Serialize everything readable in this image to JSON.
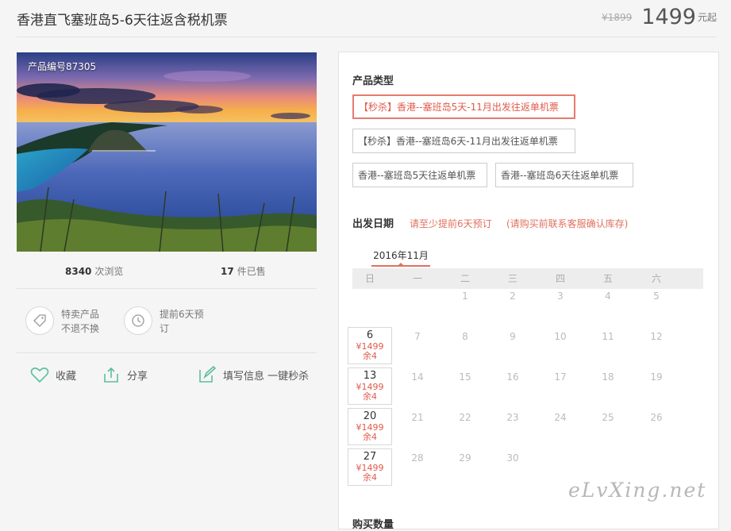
{
  "product": {
    "title": "香港直飞塞班岛5-6天往返含税机票",
    "old_price": "¥1899",
    "price": "1499",
    "price_suffix": "元起"
  },
  "gallery": {
    "code_label": "产品编号87305"
  },
  "stats": {
    "views": "8340",
    "views_label": "次浏览",
    "sold": "17",
    "sold_label": "件已售"
  },
  "features": [
    {
      "icon": "tag-icon",
      "line1": "特卖产品",
      "line2": "不退不换"
    },
    {
      "icon": "clock-icon",
      "line1": "提前6天预",
      "line2": "订"
    }
  ],
  "actions": {
    "favorite": "收藏",
    "share": "分享",
    "fill_info": "填写信息 一键秒杀"
  },
  "panel": {
    "product_type_label": "产品类型",
    "options": [
      {
        "label": "【秒杀】香港--塞班岛5天-11月出发往返单机票",
        "selected": true
      },
      {
        "label": "【秒杀】香港--塞班岛6天-11月出发往返单机票",
        "selected": false
      },
      {
        "label": "香港--塞班岛5天往返单机票",
        "selected": false
      },
      {
        "label": "香港--塞班岛6天往返单机票",
        "selected": false
      }
    ],
    "departure_label": "出发日期",
    "note1": "请至少提前6天预订",
    "note2": "(请购买前联系客服确认库存)",
    "month": "2016年11月",
    "weekdays": [
      "日",
      "一",
      "二",
      "三",
      "四",
      "五",
      "六"
    ],
    "weeks": [
      [
        null,
        null,
        "1",
        "2",
        "3",
        "4",
        "5"
      ],
      [
        {
          "day": "6",
          "price": "¥1499",
          "stock": "余4"
        },
        "7",
        "8",
        "9",
        "10",
        "11",
        "12"
      ],
      [
        {
          "day": "13",
          "price": "¥1499",
          "stock": "余4"
        },
        "14",
        "15",
        "16",
        "17",
        "18",
        "19"
      ],
      [
        {
          "day": "20",
          "price": "¥1499",
          "stock": "余4"
        },
        "21",
        "22",
        "23",
        "24",
        "25",
        "26"
      ],
      [
        {
          "day": "27",
          "price": "¥1499",
          "stock": "余4"
        },
        "28",
        "29",
        "30",
        null,
        null,
        null
      ]
    ],
    "buy_label": "购买数量"
  },
  "watermark": "eLvXing.net",
  "colors": {
    "accent": "#e05a4b",
    "icon_green": "#5bbf9c"
  }
}
